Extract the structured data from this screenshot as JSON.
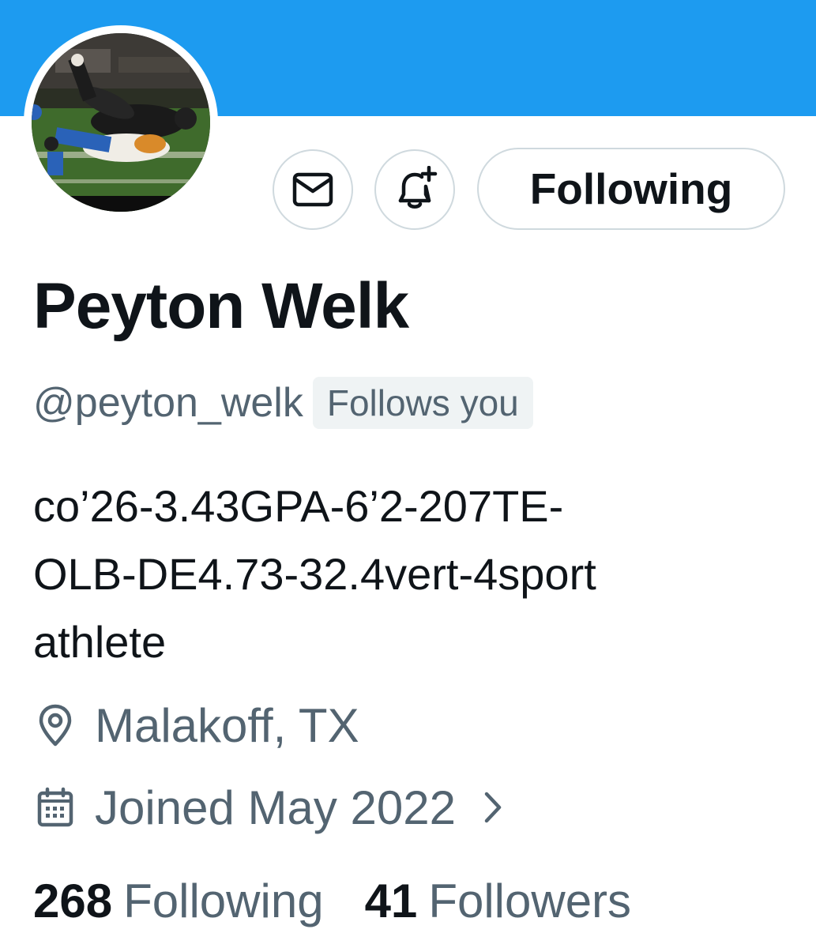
{
  "banner": {
    "color": "#1d9bf0"
  },
  "profile": {
    "avatar": {
      "alt": "profile-photo-football-tackle"
    },
    "name": "Peyton Welk",
    "handle": "@peyton_welk",
    "follows_you": "Follows you",
    "bio_lines": [
      "co’26-3.43GPA-6’2-207TE-",
      "OLB-DE4.73-32.4vert-4sport",
      "athlete"
    ],
    "location": "Malakoff, TX",
    "joined": "Joined May 2022"
  },
  "actions": {
    "message_icon": "envelope-icon",
    "notify_icon": "bell-plus-icon",
    "following_label": "Following"
  },
  "stats": {
    "following_count": "268",
    "following_label": "Following",
    "followers_count": "41",
    "followers_label": "Followers"
  },
  "colors": {
    "accent": "#1d9bf0",
    "text_primary": "#0f1419",
    "text_secondary": "#536471",
    "border": "#cfd9de",
    "badge_bg": "#eff3f4"
  }
}
